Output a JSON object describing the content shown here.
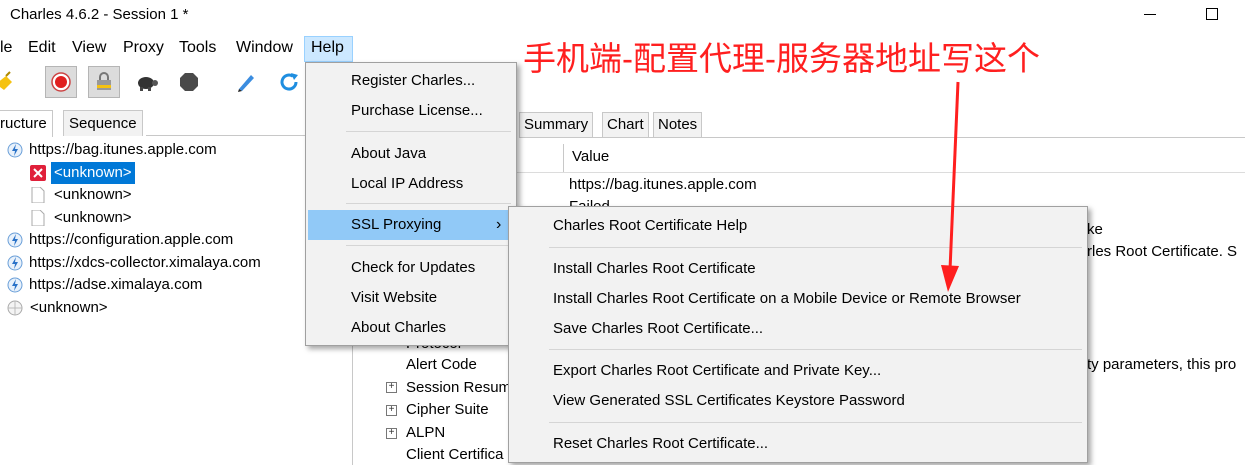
{
  "window": {
    "title": "Charles 4.6.2 - Session 1 *"
  },
  "menubar": {
    "items": [
      {
        "label": "le"
      },
      {
        "label": "Edit"
      },
      {
        "label": "View"
      },
      {
        "label": "Proxy"
      },
      {
        "label": "Tools"
      },
      {
        "label": "Window"
      },
      {
        "label": "Help"
      }
    ]
  },
  "toolbar": {
    "icons": [
      "broom-icon",
      "record-icon",
      "throttle-lock-icon",
      "turtle-icon",
      "stop-sign-icon",
      "pen-icon",
      "refresh-icon"
    ]
  },
  "left_tabs": {
    "structure": "ructure",
    "sequence": "Sequence"
  },
  "tree": {
    "rows": [
      {
        "label": "https://bag.itunes.apple.com"
      },
      {
        "label": "<unknown>"
      },
      {
        "label": "<unknown>"
      },
      {
        "label": "<unknown>"
      },
      {
        "label": "https://configuration.apple.com"
      },
      {
        "label": "https://xdcs-collector.ximalaya.com"
      },
      {
        "label": "https://adse.ximalaya.com"
      },
      {
        "label": "<unknown>"
      }
    ]
  },
  "right_tabs": {
    "summary": "Summary",
    "chart": "Chart",
    "notes": "Notes"
  },
  "right_panel": {
    "value_header": "Value",
    "value_url": "https://bag.itunes.apple.com",
    "value_failed": "Failed",
    "partial_ke": "ke",
    "partial_cert": "rles Root Certificate. S",
    "partial_params": "ty parameters, this pro",
    "protocol": "Protocol",
    "alert_code": "Alert Code",
    "session_resume": "Session Resum",
    "cipher_suite": "Cipher Suite",
    "alpn": "ALPN",
    "client_certificates": "Client Certifica"
  },
  "help_menu": {
    "items": [
      {
        "label": "Register Charles..."
      },
      {
        "label": "Purchase License..."
      },
      {
        "label": "About Java"
      },
      {
        "label": "Local IP Address"
      },
      {
        "label": "SSL Proxying",
        "arrow": "›"
      },
      {
        "label": "Check for Updates"
      },
      {
        "label": "Visit Website"
      },
      {
        "label": "About Charles"
      }
    ]
  },
  "ssl_submenu": {
    "items": [
      {
        "label": "Charles Root Certificate Help"
      },
      {
        "label": "Install Charles Root Certificate"
      },
      {
        "label": "Install Charles Root Certificate on a Mobile Device or Remote Browser"
      },
      {
        "label": "Save Charles Root Certificate..."
      },
      {
        "label": "Export Charles Root Certificate and Private Key..."
      },
      {
        "label": "View Generated SSL Certificates Keystore Password"
      },
      {
        "label": "Reset Charles Root Certificate..."
      }
    ]
  },
  "annotation": {
    "text": "手机端-配置代理-服务器地址写这个",
    "color": "#ff1f1f"
  },
  "colors": {
    "selection": "#0078d7",
    "menu_hover": "#91c9f7",
    "menu_bg": "#f2f2f2",
    "active_menu": "#cce8ff"
  }
}
